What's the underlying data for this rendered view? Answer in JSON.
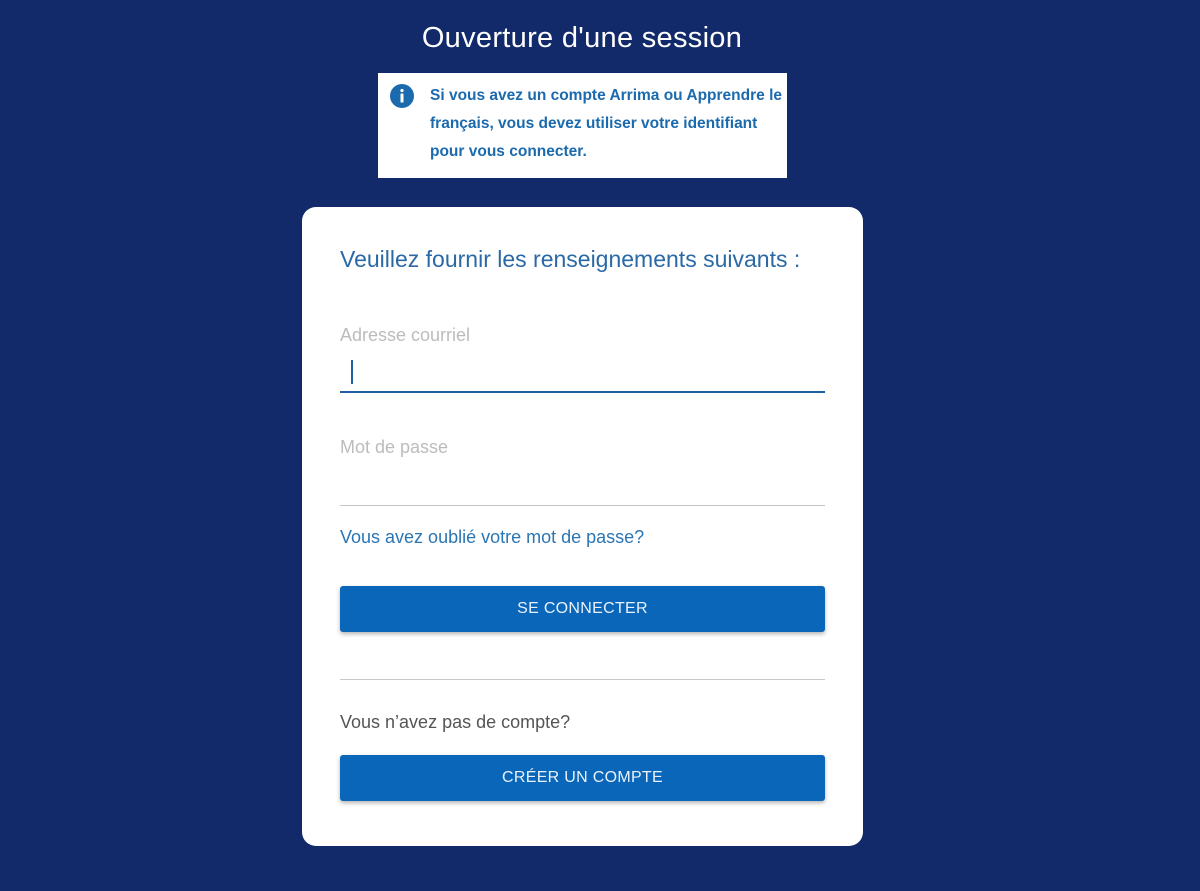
{
  "page": {
    "title": "Ouverture d'une session"
  },
  "info_banner": {
    "icon": "info-icon",
    "message": "Si vous avez un compte Arrima ou Apprendre le français, vous devez utiliser votre identifiant pour vous connecter."
  },
  "form": {
    "heading": "Veuillez fournir les renseignements suivants :",
    "email_label": "Adresse courriel",
    "email_value": "",
    "password_label": "Mot de passe",
    "password_value": "",
    "forgot_password_link": "Vous avez oublié votre mot de passe?",
    "login_button": "SE CONNECTER",
    "no_account_text": "Vous n’avez pas de compte?",
    "create_account_button": "CRÉER UN COMPTE"
  },
  "colors": {
    "background": "#122a6a",
    "primary_button": "#0a66b8",
    "accent_text": "#2a69a6",
    "card": "#ffffff"
  }
}
